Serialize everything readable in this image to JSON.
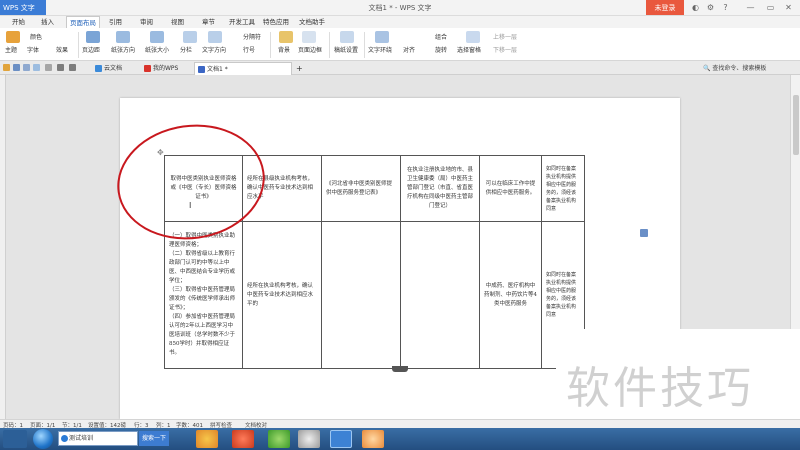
{
  "titlebar": {
    "app_menu": "WPS 文字",
    "window_title": "文档1 * - WPS 文字",
    "login": "未登录"
  },
  "menu_tabs": [
    "开始",
    "插入",
    "页面布局",
    "引用",
    "审阅",
    "视图",
    "章节",
    "开发工具",
    "特色应用",
    "文档助手"
  ],
  "active_menu_tab": "页面布局",
  "ribbon": {
    "theme": "主题",
    "colors": "颜色",
    "fonts": "字体",
    "effects": "效果",
    "margins": "页边距",
    "orientation": "纸张方向",
    "size": "纸张大小",
    "columns": "分栏",
    "text_direction": "文字方向",
    "breaks": "分隔符",
    "line_numbers": "行号",
    "background": "背景",
    "page_border": "页面边框",
    "draft_setting": "稿纸设置",
    "text_wrap": "文字环绕",
    "align": "对齐",
    "group": "组合",
    "rotate": "旋转",
    "selection_pane": "选择窗格",
    "bring_forward": "上移一层",
    "send_backward": "下移一层"
  },
  "doc_tabs": [
    {
      "label": "云文档",
      "color": "#3b8ad9"
    },
    {
      "label": "我的WPS",
      "color": "#d9332b"
    },
    {
      "label": "文档1 *",
      "color": "#3b66c4"
    }
  ],
  "new_tab": "+",
  "search_placeholder": "查找命令、搜索模板",
  "table": {
    "row1": [
      "取得中医类别执业医师资格或《中医（专长）医师资格证书》",
      "经所在县级执业机构考核，确认中医药专业技术达到相应水平",
      "《河北省非中医类别医师提供中医药服务登记表》",
      "在执业注册执业地的市、县卫生健康委（局）中医药主管部门登记（市直、省直医疗机构在同级中医药主管部门登记）",
      "可以在临床工作中提供相应中医药服务。",
      "如同时在备案执业机构提供相应中医药服务的，须经该备案执业机构同意"
    ],
    "row2_col1": [
      "（一）取得中医类别执业助理医师资格；",
      "（二）取得省级以上教育行政部门认可的中等以上中医、中西医结合专业学历或学位；",
      "（三）取得省中医药管理局颁发的《传统医学师承出师证书》；",
      "（四）参加省中医药管理局认可的2年以上西医学习中医培训班（总学时数不少于850学时）并取得相应证书。"
    ],
    "row2": [
      "",
      "经所在执业机构考核，确认中医药专业技术达到相应水平的",
      "",
      "",
      "中成药、医疗机构中药制剂、中药饮片等4类中医药服务",
      "如同时在备案执业机构提供相应中医药服务的，须经该备案执业机构同意"
    ]
  },
  "watermark": "软件技巧",
  "status": {
    "page": "页码：1",
    "pages": "页面：1/1",
    "section": "节：1/1",
    "setting": "设置值：142磅",
    "row": "行：3",
    "col": "列：1",
    "words": "字数：401",
    "spell": "拼写检查",
    "proof": "文档校对"
  },
  "taskbar": {
    "input_value": "测试培训",
    "search_button": "搜索一下"
  },
  "colors": {
    "accent": "#3b7cd6",
    "login": "#e9583e",
    "annotation": "#c8181e"
  }
}
